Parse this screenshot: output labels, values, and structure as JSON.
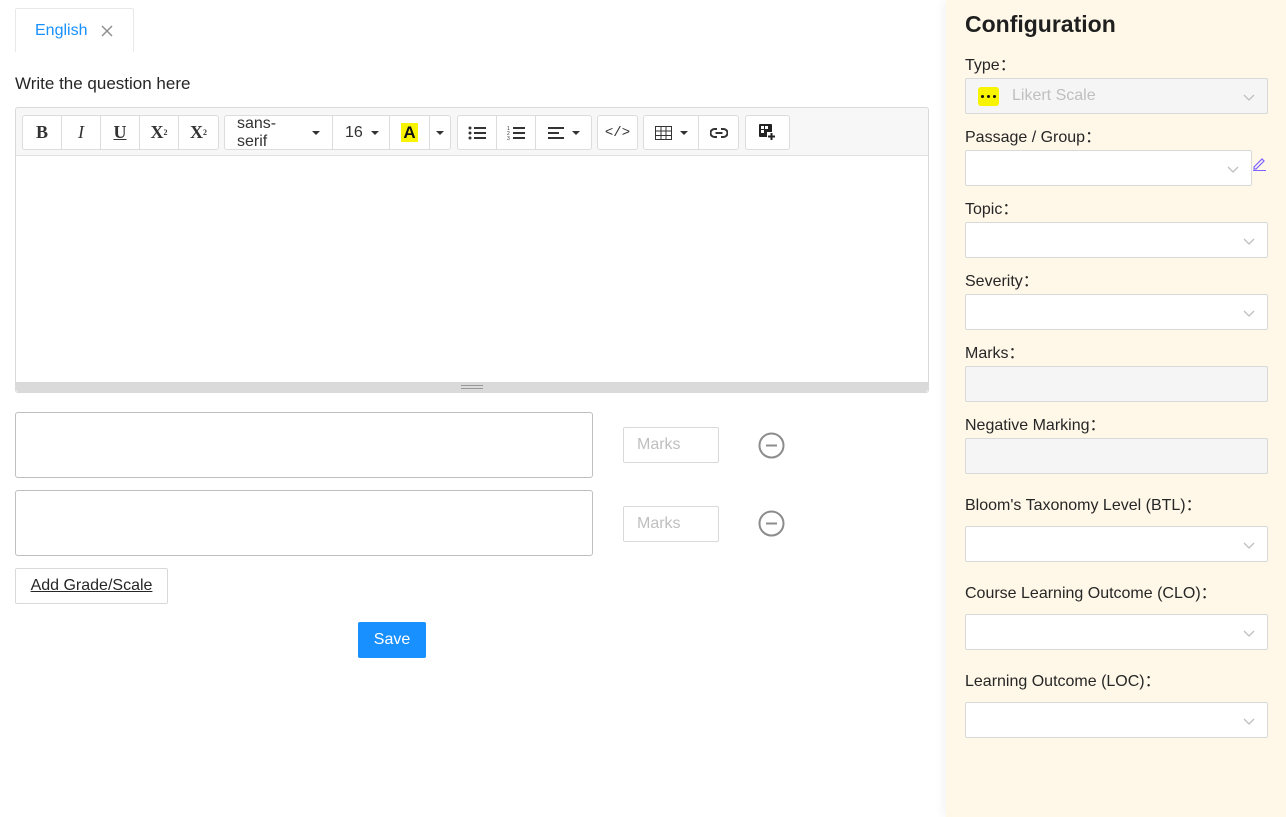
{
  "tab": {
    "label": "English",
    "close_icon": "close-icon"
  },
  "question": {
    "prompt": "Write the question here"
  },
  "toolbar": {
    "bold": "B",
    "italic": "I",
    "underline": "U",
    "superscript": "X",
    "subscript": "X",
    "font_family": "sans-serif",
    "font_size": "16",
    "color": "A",
    "highlight_color": "#f8f400"
  },
  "options": [
    {
      "marks_placeholder": "Marks"
    },
    {
      "marks_placeholder": "Marks"
    }
  ],
  "actions": {
    "add_grade": "Add Grade/Scale",
    "save": "Save"
  },
  "config": {
    "title": "Configuration",
    "fields": {
      "type": {
        "label": "Type：",
        "value": "Likert Scale"
      },
      "passage_group": {
        "label": "Passage / Group："
      },
      "topic": {
        "label": "Topic："
      },
      "severity": {
        "label": "Severity："
      },
      "marks": {
        "label": "Marks："
      },
      "negative_marking": {
        "label": "Negative Marking："
      },
      "btl": {
        "label": "Bloom's Taxonomy Level (BTL)："
      },
      "clo": {
        "label": "Course Learning Outcome (CLO)："
      },
      "loc": {
        "label": "Learning Outcome (LOC)："
      }
    }
  },
  "colors": {
    "accent": "#1890ff",
    "panel_bg": "#fff8e8"
  }
}
